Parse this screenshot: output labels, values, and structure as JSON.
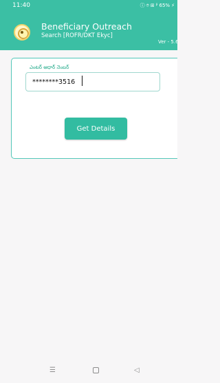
{
  "status_bar": {
    "time": "11:40",
    "icons": [
      "ⓘ",
      "⌾",
      "⊞",
      "ᵝ",
      "65%",
      "⚡"
    ],
    "battery": "65%"
  },
  "header": {
    "title": "Beneficiary Outreach",
    "subtitle": "Search [ROFR/DKT Ekyc]",
    "version": "Ver - 5.6"
  },
  "form": {
    "label": "ఎంటర్ ఆధార్ నెంబర్",
    "input_value": "********3516",
    "button_label": "Get Details"
  },
  "navigation": {
    "menu_icon": "menu-icon",
    "home_icon": "home-icon",
    "back_icon": "back-icon"
  },
  "colors": {
    "header": "#3bbfa4",
    "accent": "#32bca1",
    "background": "#f7f6f7"
  }
}
